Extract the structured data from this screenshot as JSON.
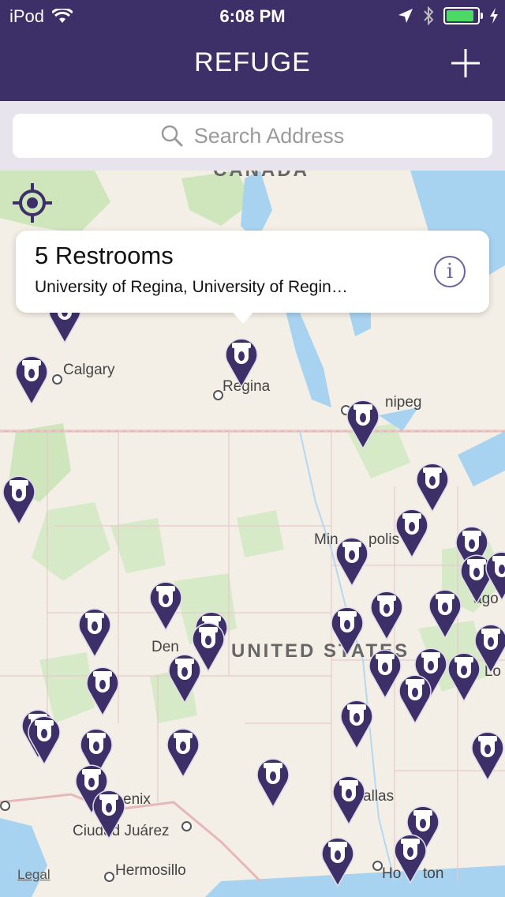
{
  "status_bar": {
    "carrier": "iPod",
    "time": "6:08 PM"
  },
  "nav": {
    "title": "REFUGE",
    "add_icon": "plus-icon"
  },
  "search": {
    "placeholder": "Search Address",
    "icon": "search-icon"
  },
  "map": {
    "labels": {
      "canada": "CANADA",
      "united_states": "UNITED STATES",
      "calgary": "Calgary",
      "regina": "Regina",
      "winnipeg": "nipeg",
      "minneapolis": "Min",
      "minneapolis_end": "polis",
      "denver": "Den",
      "chicago": "ago",
      "st_louis": "t. Lo",
      "dallas": "allas",
      "phoenix": "enix",
      "ciudad_juarez": "Ciudad Juárez",
      "hermosillo": "Hermosillo",
      "houston": "Ho",
      "houston_end": "ton",
      "legal": "Legal"
    },
    "pin_color": "#3d3068",
    "water_color": "#a8d3f0",
    "park_color": "#c9e2b8"
  },
  "callout": {
    "title": "5 Restrooms",
    "subtitle": "University of Regina, University of Regin…",
    "info_icon_glyph": "i"
  },
  "colors": {
    "brand": "#3d3068",
    "battery": "#4cd964"
  }
}
